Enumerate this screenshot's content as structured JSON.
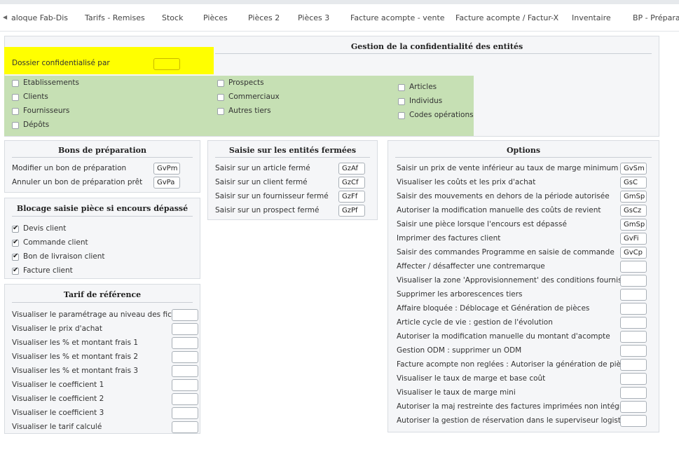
{
  "tabs": [
    "aloque Fab-Dis",
    "Tarifs - Remises",
    "Stock",
    "Pièces",
    "Pièces 2",
    "Pièces 3",
    "Facture acompte - vente",
    "Facture acompte / Factur-X",
    "Inventaire",
    "BP - Préparatio"
  ],
  "confidentialite": {
    "title": "Gestion de la confidentialité des entités",
    "dossier_label": "Dossier confidentialisé par",
    "dossier_value": "",
    "col1": [
      "Etablissements",
      "Clients",
      "Fournisseurs",
      "Dépôts"
    ],
    "col2": [
      "Prospects",
      "Commerciaux",
      "Autres tiers"
    ],
    "col3": [
      "Articles",
      "Individus",
      "Codes opérations"
    ]
  },
  "bons": {
    "title": "Bons de préparation",
    "rows": [
      {
        "label": "Modifier un bon de préparation",
        "code": "GvPm"
      },
      {
        "label": "Annuler un bon de préparation prêt",
        "code": "GvPa"
      }
    ]
  },
  "blocage": {
    "title": "Blocage saisie pièce si encours dépassé",
    "items": [
      "Devis client",
      "Commande client",
      "Bon de livraison client",
      "Facture client"
    ]
  },
  "tarif": {
    "title": "Tarif de référence",
    "rows": [
      {
        "label": "Visualiser le paramétrage au niveau des fiches",
        "code": ""
      },
      {
        "label": "Visualiser le prix d'achat",
        "code": ""
      },
      {
        "label": "Visualiser les % et montant frais 1",
        "code": ""
      },
      {
        "label": "Visualiser les % et montant frais 2",
        "code": ""
      },
      {
        "label": "Visualiser les % et montant frais 3",
        "code": ""
      },
      {
        "label": "Visualiser le coefficient 1",
        "code": ""
      },
      {
        "label": "Visualiser le coefficient 2",
        "code": ""
      },
      {
        "label": "Visualiser le coefficient 3",
        "code": ""
      },
      {
        "label": "Visualiser le tarif calculé",
        "code": ""
      }
    ]
  },
  "fermees": {
    "title": "Saisie sur les entités fermées",
    "rows": [
      {
        "label": "Saisir sur un article fermé",
        "code": "GzAf"
      },
      {
        "label": "Saisir sur un client fermé",
        "code": "GzCf"
      },
      {
        "label": "Saisir sur un fournisseur fermé",
        "code": "GzFf"
      },
      {
        "label": "Saisir sur un prospect fermé",
        "code": "GzPf"
      }
    ]
  },
  "options": {
    "title": "Options",
    "rows": [
      {
        "label": "Saisir un prix de vente inférieur au taux de marge minimum",
        "code": "GvSm"
      },
      {
        "label": "Visualiser les coûts et les prix d'achat",
        "code": "GsC"
      },
      {
        "label": "Saisir des mouvements en dehors de la période autorisée",
        "code": "GmSp"
      },
      {
        "label": "Autoriser la modification manuelle des coûts de revient",
        "code": "GsCz"
      },
      {
        "label": "Saisir une pièce lorsque l'encours est dépassé",
        "code": "GmSp"
      },
      {
        "label": "Imprimer des factures client",
        "code": "GvFi"
      },
      {
        "label": "Saisir des commandes Programme en saisie de commande",
        "code": "GvCp"
      },
      {
        "label": "Affecter / désaffecter une contremarque",
        "code": ""
      },
      {
        "label": "Visualiser la zone 'Approvisionnement' des conditions fournisseur",
        "code": ""
      },
      {
        "label": "Supprimer les arborescences tiers",
        "code": ""
      },
      {
        "label": "Affaire bloquée : Déblocage et Génération de pièces",
        "code": ""
      },
      {
        "label": "Article cycle de vie : gestion de l'évolution",
        "code": ""
      },
      {
        "label": "Autoriser la modification manuelle du montant d'acompte",
        "code": ""
      },
      {
        "label": "Gestion ODM : supprimer un ODM",
        "code": ""
      },
      {
        "label": "Facture acompte non reglées : Autoriser la génération de pièces",
        "code": ""
      },
      {
        "label": "Visualiser le taux de marge et base coût",
        "code": ""
      },
      {
        "label": "Visualiser le taux de marge mini",
        "code": ""
      },
      {
        "label": "Autoriser la maj restreinte des factures imprimées non intégrées",
        "code": ""
      },
      {
        "label": "Autoriser la gestion de réservation dans le superviseur logistique",
        "code": ""
      }
    ]
  },
  "colors": {
    "highlight_yellow": "#ffff00",
    "highlight_green": "#c6e0b4"
  }
}
